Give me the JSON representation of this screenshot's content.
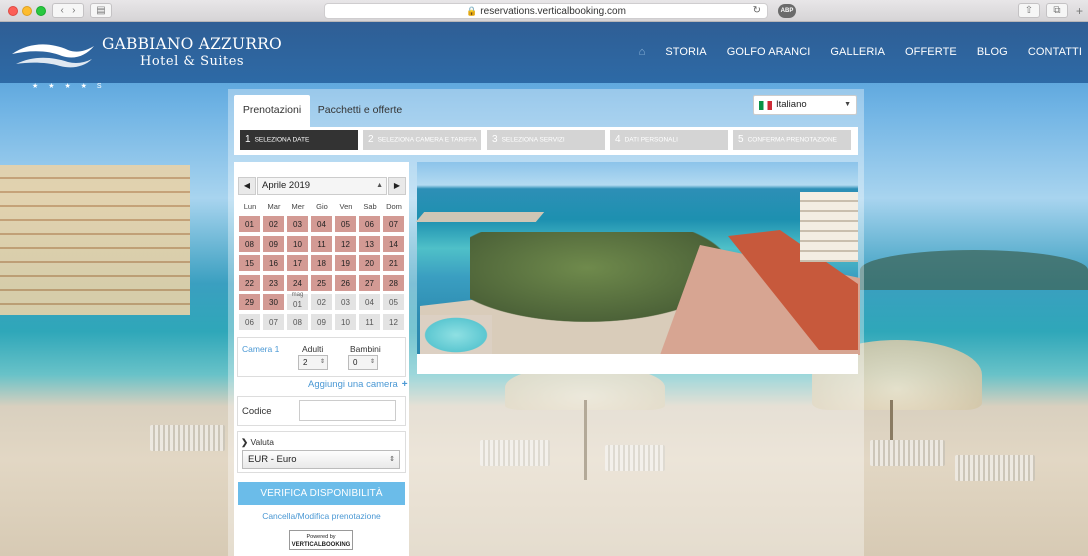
{
  "browser": {
    "url": "reservations.verticalbooking.com"
  },
  "site": {
    "logo_name": "GABBIANO AZZURRO",
    "logo_sub": "Hotel & Suites",
    "logo_stars": "★ ★ ★ ★ S",
    "nav": [
      "STORIA",
      "GOLFO ARANCI",
      "GALLERIA",
      "OFFERTE",
      "BLOG",
      "CONTATTI"
    ]
  },
  "booking": {
    "tabs": {
      "active": "Prenotazioni",
      "inactive": "Pacchetti e offerte"
    },
    "language": "Italiano",
    "steps": [
      {
        "num": "1",
        "label": "SELEZIONA DATE"
      },
      {
        "num": "2",
        "label": "SELEZIONA CAMERA E TARIFFA"
      },
      {
        "num": "3",
        "label": "SELEZIONA SERVIZI"
      },
      {
        "num": "4",
        "label": "DATI PERSONALI"
      },
      {
        "num": "5",
        "label": "CONFERMA PRENOTAZIONE"
      }
    ],
    "calendar": {
      "month": "Aprile 2019",
      "weekdays": [
        "Lun",
        "Mar",
        "Mer",
        "Gio",
        "Ven",
        "Sab",
        "Dom"
      ],
      "next_month_label": "mag",
      "weeks": [
        [
          "01",
          "02",
          "03",
          "04",
          "05",
          "06",
          "07"
        ],
        [
          "08",
          "09",
          "10",
          "11",
          "12",
          "13",
          "14"
        ],
        [
          "15",
          "16",
          "17",
          "18",
          "19",
          "20",
          "21"
        ],
        [
          "22",
          "23",
          "24",
          "25",
          "26",
          "27",
          "28"
        ],
        [
          "29",
          "30",
          "01",
          "02",
          "03",
          "04",
          "05"
        ],
        [
          "06",
          "07",
          "08",
          "09",
          "10",
          "11",
          "12"
        ]
      ]
    },
    "room": {
      "camera_label": "Camera 1",
      "adults_label": "Adulti",
      "adults_value": "2",
      "children_label": "Bambini",
      "children_value": "0"
    },
    "add_room": "Aggiungi una camera",
    "code_label": "Codice",
    "currency_label": "Valuta",
    "currency_value": "EUR - Euro",
    "check_button": "VERIFICA DISPONIBILITÀ",
    "cancel_link": "Cancella/Modifica prenotazione",
    "powered_top": "Powered by",
    "powered_brand": "VERTICALBOOKING"
  }
}
